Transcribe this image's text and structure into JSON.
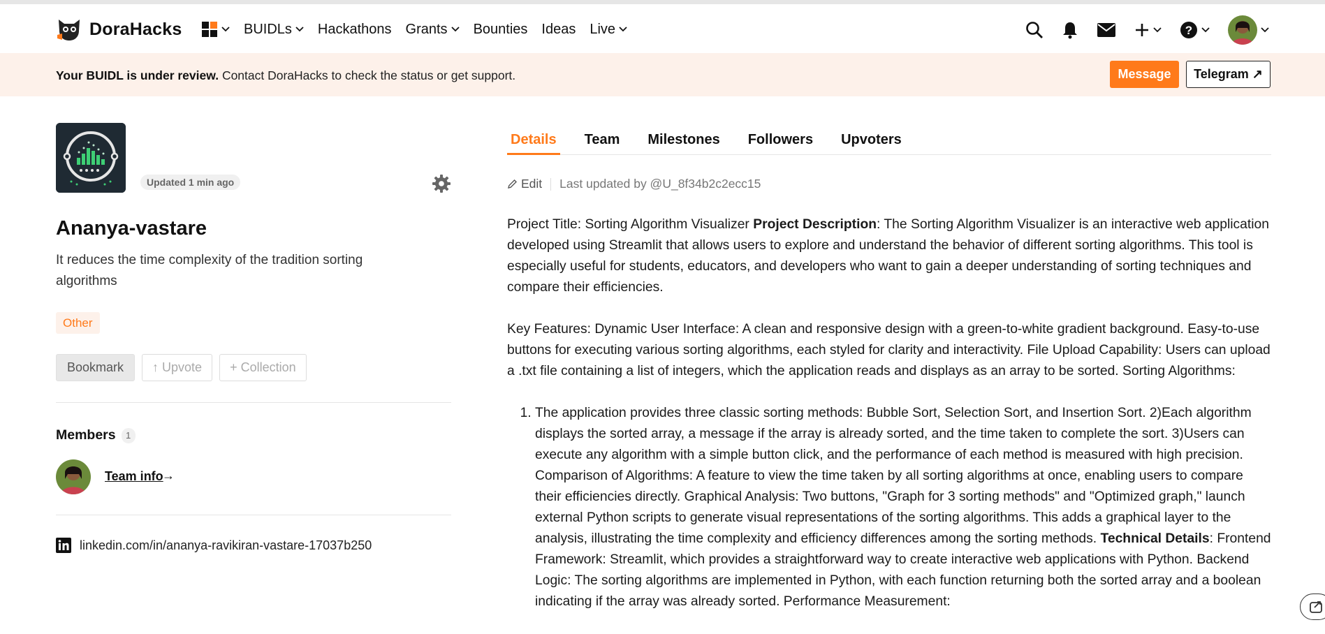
{
  "nav": {
    "brand": "DoraHacks",
    "items": [
      {
        "label": "BUIDLs",
        "dropdown": true
      },
      {
        "label": "Hackathons",
        "dropdown": false
      },
      {
        "label": "Grants",
        "dropdown": true
      },
      {
        "label": "Bounties",
        "dropdown": false
      },
      {
        "label": "Ideas",
        "dropdown": false
      },
      {
        "label": "Live",
        "dropdown": true
      }
    ],
    "icons": [
      "apps-grid-icon",
      "search-icon",
      "bell-icon",
      "mail-icon",
      "plus-icon",
      "help-icon",
      "avatar"
    ]
  },
  "banner": {
    "bold": "Your BUIDL is under review.",
    "text": " Contact DoraHacks to check the status or get support.",
    "message_label": "Message",
    "telegram_label": "Telegram ↗"
  },
  "project": {
    "updated": "Updated 1 min ago",
    "name": "Ananya-vastare",
    "tagline": "It reduces the time complexity of the tradition sorting algorithms",
    "tag": "Other",
    "bookmark_label": "Bookmark",
    "upvote_label": "↑ Upvote",
    "collection_label": "+ Collection"
  },
  "members": {
    "title": "Members",
    "count": "1",
    "team_info": "Team info",
    "arrow": "→"
  },
  "links": {
    "linkedin": "linkedin.com/in/ananya-ravikiran-vastare-17037b250"
  },
  "tabs": [
    {
      "label": "Details",
      "active": true
    },
    {
      "label": "Team",
      "active": false
    },
    {
      "label": "Milestones",
      "active": false
    },
    {
      "label": "Followers",
      "active": false
    },
    {
      "label": "Upvoters",
      "active": false
    }
  ],
  "details": {
    "edit_label": "Edit",
    "last_updated": "Last updated by @U_8f34b2c2ecc15",
    "p1_a": "Project Title: Sorting Algorithm Visualizer ",
    "p1_b": "Project Description",
    "p1_c": ": The Sorting Algorithm Visualizer is an interactive web application developed using Streamlit that allows users to explore and understand the behavior of different sorting algorithms. This tool is especially useful for students, educators, and developers who want to gain a deeper understanding of sorting techniques and compare their efficiencies.",
    "p2": "Key Features: Dynamic User Interface: A clean and responsive design with a green-to-white gradient background. Easy-to-use buttons for executing various sorting algorithms, each styled for clarity and interactivity. File Upload Capability: Users can upload a .txt file containing a list of integers, which the application reads and displays as an array to be sorted. Sorting Algorithms:",
    "li1_a": "The application provides three classic sorting methods: Bubble Sort, Selection Sort, and Insertion Sort. 2)Each algorithm displays the sorted array, a message if the array is already sorted, and the time taken to complete the sort. 3)Users can execute any algorithm with a simple button click, and the performance of each method is measured with high precision. Comparison of Algorithms: A feature to view the time taken by all sorting algorithms at once, enabling users to compare their efficiencies directly. Graphical Analysis: Two buttons, \"Graph for 3 sorting methods\" and \"Optimized graph,\" launch external Python scripts to generate visual representations of the sorting algorithms. This adds a graphical layer to the analysis, illustrating the time complexity and efficiency differences among the sorting methods. ",
    "li1_b": "Technical Details",
    "li1_c": ": Frontend Framework: Streamlit, which provides a straightforward way to create interactive web applications with Python. Backend Logic: The sorting algorithms are implemented in Python, with each function returning both the sorted array and a boolean indicating if the array was already sorted. Performance Measurement:"
  },
  "colors": {
    "accent": "#ff7a1a",
    "banner_bg": "#fdf1ea"
  }
}
